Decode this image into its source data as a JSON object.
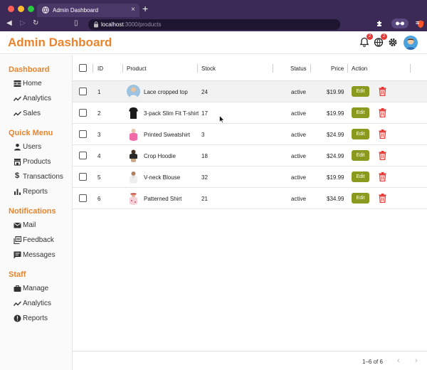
{
  "browser": {
    "tab_title": "Admin Dashboard",
    "url_host": "localhost",
    "url_path": ":3000/products"
  },
  "header": {
    "title": "Admin Dashboard",
    "notification_count": "2",
    "language_count": "2"
  },
  "sidebar": {
    "sections": [
      {
        "title": "Dashboard",
        "items": [
          {
            "label": "Home",
            "icon": "home-icon"
          },
          {
            "label": "Analytics",
            "icon": "trending-icon"
          },
          {
            "label": "Sales",
            "icon": "trending-icon"
          }
        ]
      },
      {
        "title": "Quick Menu",
        "items": [
          {
            "label": "Users",
            "icon": "person-icon"
          },
          {
            "label": "Products",
            "icon": "store-icon"
          },
          {
            "label": "Transactions",
            "icon": "dollar-icon"
          },
          {
            "label": "Reports",
            "icon": "bar-chart-icon"
          }
        ]
      },
      {
        "title": "Notifications",
        "items": [
          {
            "label": "Mail",
            "icon": "mail-icon"
          },
          {
            "label": "Feedback",
            "icon": "feedback-icon"
          },
          {
            "label": "Messages",
            "icon": "message-icon"
          }
        ]
      },
      {
        "title": "Staff",
        "items": [
          {
            "label": "Manage",
            "icon": "briefcase-icon"
          },
          {
            "label": "Analytics",
            "icon": "trending-icon"
          },
          {
            "label": "Reports",
            "icon": "report-icon"
          }
        ]
      }
    ]
  },
  "table": {
    "columns": {
      "id": "ID",
      "product": "Product",
      "stock": "Stock",
      "status": "Status",
      "price": "Price",
      "action": "Action"
    },
    "edit_label": "Edit",
    "rows": [
      {
        "id": "1",
        "product": "Lace cropped top",
        "stock": "24",
        "status": "active",
        "price": "$19.99"
      },
      {
        "id": "2",
        "product": "3-pack Slim Fit T-shirt",
        "stock": "17",
        "status": "active",
        "price": "$19.99"
      },
      {
        "id": "3",
        "product": "Printed Sweatshirt",
        "stock": "3",
        "status": "active",
        "price": "$24.99"
      },
      {
        "id": "4",
        "product": "Crop Hoodie",
        "stock": "18",
        "status": "active",
        "price": "$24.99"
      },
      {
        "id": "5",
        "product": "V-neck Blouse",
        "stock": "32",
        "status": "active",
        "price": "$19.99"
      },
      {
        "id": "6",
        "product": "Patterned Shirt",
        "stock": "21",
        "status": "active",
        "price": "$34.99"
      }
    ],
    "pagination": "1–6 of 6"
  },
  "colors": {
    "accent": "#e8842c",
    "edit_button": "#8a9a1e",
    "delete_icon": "#e53935"
  }
}
